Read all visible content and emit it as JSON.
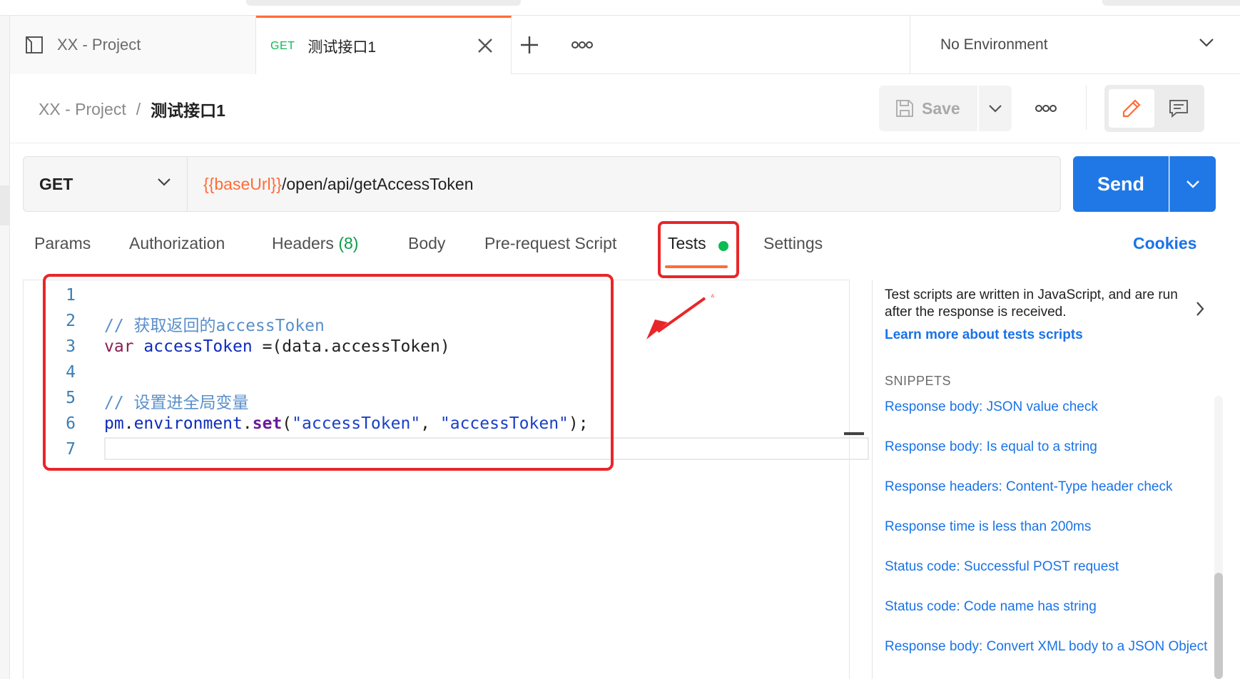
{
  "tabs": [
    {
      "label": "XX - Project"
    },
    {
      "method": "GET",
      "label": "测试接口1"
    }
  ],
  "environment": {
    "label": "No Environment"
  },
  "breadcrumb": {
    "parent": "XX - Project",
    "separator": "/",
    "current": "测试接口1"
  },
  "toolbar": {
    "save_label": "Save"
  },
  "request": {
    "method": "GET",
    "url_variable": "{{baseUrl}}",
    "url_path": "/open/api/getAccessToken",
    "send_label": "Send"
  },
  "subtabs": {
    "params": "Params",
    "authorization": "Authorization",
    "headers": "Headers",
    "headers_count": "(8)",
    "body": "Body",
    "prerequest": "Pre-request Script",
    "tests": "Tests",
    "settings": "Settings",
    "cookies": "Cookies"
  },
  "editor": {
    "line_numbers": [
      "1",
      "2",
      "3",
      "4",
      "5",
      "6",
      "7"
    ],
    "line2": "// 获取返回的accessToken",
    "line3_kw": "var",
    "line3_id": "accessToken",
    "line3_rest": " =(data.accessToken)",
    "line5": "// 设置进全局变量",
    "line6_obj": "pm",
    "line6_dot1": ".",
    "line6_prop": "environment",
    "line6_dot2": ".",
    "line6_fn": "set",
    "line6_open": "(",
    "line6_arg1": "\"accessToken\"",
    "line6_comma": ", ",
    "line6_arg2": "\"accessToken\"",
    "line6_close": ");"
  },
  "side_panel": {
    "description": "Test scripts are written in JavaScript, and are run after the response is received.",
    "learn_more": "Learn more about tests scripts",
    "snippets_title": "SNIPPETS",
    "snippets": [
      "Response body: JSON value check",
      "Response body: Is equal to a string",
      "Response headers: Content-Type header check",
      "Response time is less than 200ms",
      "Status code: Successful POST request",
      "Status code: Code name has string",
      "Response body: Convert XML body to a JSON Object"
    ]
  },
  "colors": {
    "accent": "#ff6c37",
    "send": "#1f78e6",
    "link": "#1a73e8",
    "status_green": "#0cbb52",
    "annotation_red": "#e8262a"
  },
  "icons": [
    "collection-icon",
    "close-icon",
    "plus-icon",
    "more-icon",
    "chevron-down-icon",
    "save-icon",
    "edit-icon",
    "comments-icon",
    "chevron-right-icon",
    "arrow-annotation"
  ]
}
